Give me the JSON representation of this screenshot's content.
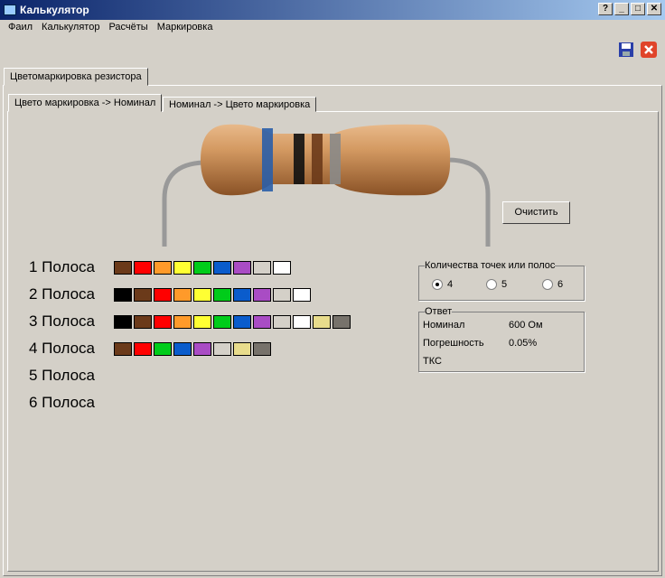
{
  "window": {
    "title": "Калькулятор",
    "help": "?",
    "minimize": "_",
    "maximize": "□",
    "close": "✕"
  },
  "menu": [
    "Фаил",
    "Калькулятор",
    "Расчёты",
    "Маркировка"
  ],
  "toolbar": {
    "save_icon": "floppy-disk",
    "close_icon": "red-x"
  },
  "outer_tab": "Цветомаркировка резистора",
  "inner_tabs": [
    "Цвето маркировка -> Номинал",
    "Номинал -> Цвето маркировка"
  ],
  "resistor_bands": [
    "#2a5ea8",
    "#111111",
    "#6b3a1a",
    "#8a8a88"
  ],
  "clear_button": "Очистить",
  "rows": [
    {
      "label": "1 Полоса",
      "colors": [
        "#6b3a1a",
        "#ff0000",
        "#ff9a2a",
        "#ffff33",
        "#00cc1a",
        "#0a5ccc",
        "#a94cc4",
        "#d4d0c8",
        "#ffffff"
      ]
    },
    {
      "label": "2 Полоса",
      "colors": [
        "#000000",
        "#6b3a1a",
        "#ff0000",
        "#ff9a2a",
        "#ffff33",
        "#00cc1a",
        "#0a5ccc",
        "#a94cc4",
        "#d4d0c8",
        "#ffffff"
      ]
    },
    {
      "label": "3 Полоса",
      "colors": [
        "#000000",
        "#6b3a1a",
        "#ff0000",
        "#ff9a2a",
        "#ffff33",
        "#00cc1a",
        "#0a5ccc",
        "#a94cc4",
        "#d4d0c8",
        "#ffffff",
        "#e8dc8c",
        "#77726b"
      ]
    },
    {
      "label": "4 Полоса",
      "colors": [
        "#6b3a1a",
        "#ff0000",
        "#00cc1a",
        "#0a5ccc",
        "#a94cc4",
        "#d4d0c8",
        "#e8dc8c",
        "#77726b"
      ]
    },
    {
      "label": "5 Полоса",
      "colors": []
    },
    {
      "label": "6 Полоса",
      "colors": []
    }
  ],
  "bands_group": {
    "title": "Количества точек или полос",
    "options": [
      "4",
      "5",
      "6"
    ],
    "selected": "4"
  },
  "answer": {
    "title": "Ответ",
    "nominal_label": "Номинал",
    "nominal_value": "600 Ом",
    "tolerance_label": "Погрешность",
    "tolerance_value": "0.05%",
    "tks_label": "ТКС",
    "tks_value": ""
  }
}
